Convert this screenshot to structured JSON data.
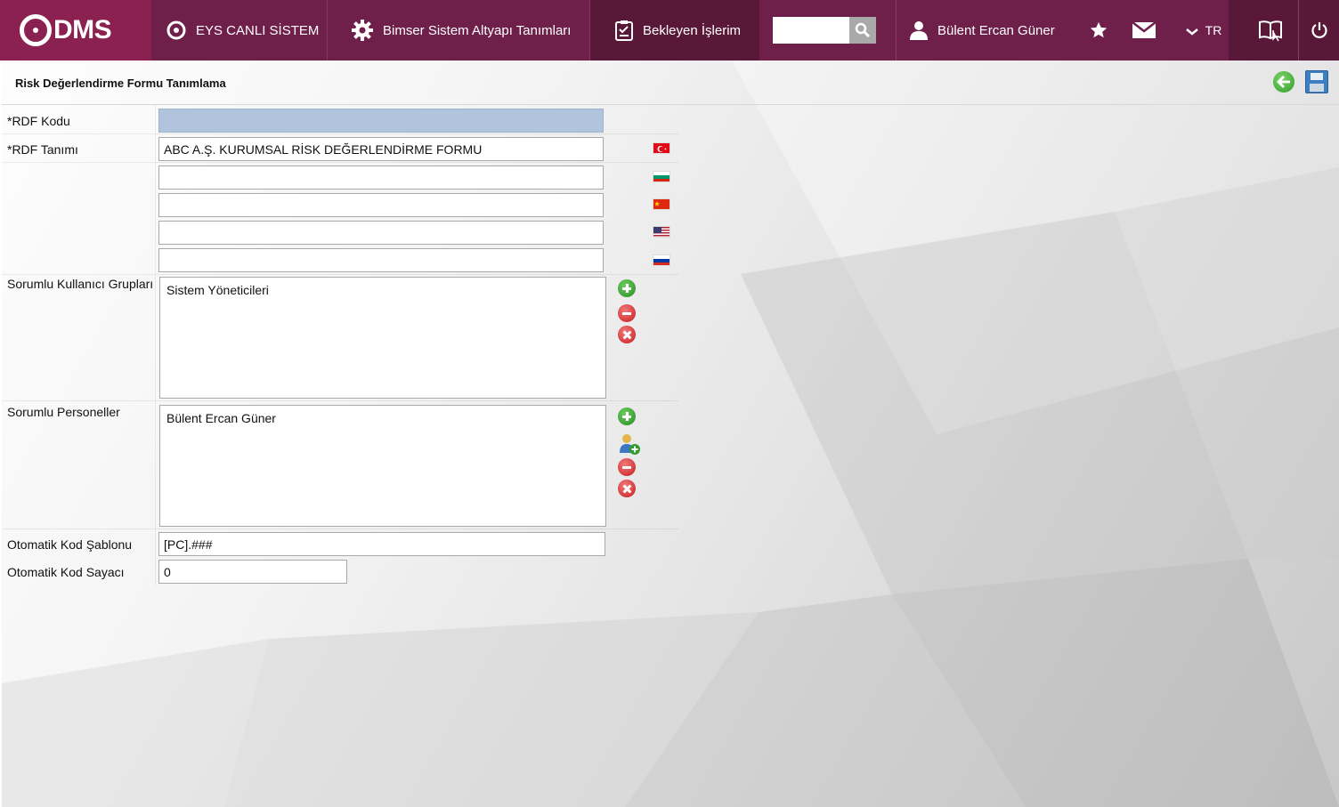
{
  "header": {
    "logo_text": "DMS",
    "nav": {
      "system_label": "EYS CANLI SİSTEM",
      "infra_label": "Bimser Sistem Altyapı Tanımları",
      "pending_label": "Bekleyen İşlerim"
    },
    "search": {
      "value": "",
      "icon": "search-icon"
    },
    "user_name": "Bülent Ercan Güner",
    "language": "TR",
    "icons": [
      "user-icon",
      "star-icon",
      "mail-icon",
      "chevron-down-icon",
      "book-icon",
      "power-icon"
    ],
    "colors": {
      "bar": "#6e1f4a",
      "logo_bg": "#8a2150"
    }
  },
  "page": {
    "title": "Risk Değerlendirme Formu Tanımlama",
    "back_icon": "back-arrow-icon",
    "save_icon": "save-icon"
  },
  "form": {
    "rdf_code": {
      "label": "*RDF Kodu",
      "value": ""
    },
    "rdf_name": {
      "label": "*RDF Tanımı",
      "translations": [
        {
          "lang_icon": "flag-tr-icon",
          "value": "ABC A.Ş. KURUMSAL RİSK DEĞERLENDİRME FORMU"
        },
        {
          "lang_icon": "flag-bg-icon",
          "value": ""
        },
        {
          "lang_icon": "flag-cn-icon",
          "value": ""
        },
        {
          "lang_icon": "flag-us-icon",
          "value": ""
        },
        {
          "lang_icon": "flag-ru-icon",
          "value": ""
        }
      ]
    },
    "responsible_groups": {
      "label": "Sorumlu Kullanıcı Grupları",
      "items": [
        "Sistem Yöneticileri"
      ]
    },
    "responsible_personnel": {
      "label": "Sorumlu Personeller",
      "items": [
        "Bülent Ercan Güner"
      ]
    },
    "auto_code_template": {
      "label": "Otomatik Kod Şablonu",
      "value": "[PC].###"
    },
    "auto_code_counter": {
      "label": "Otomatik Kod Sayacı",
      "value": "0"
    }
  }
}
